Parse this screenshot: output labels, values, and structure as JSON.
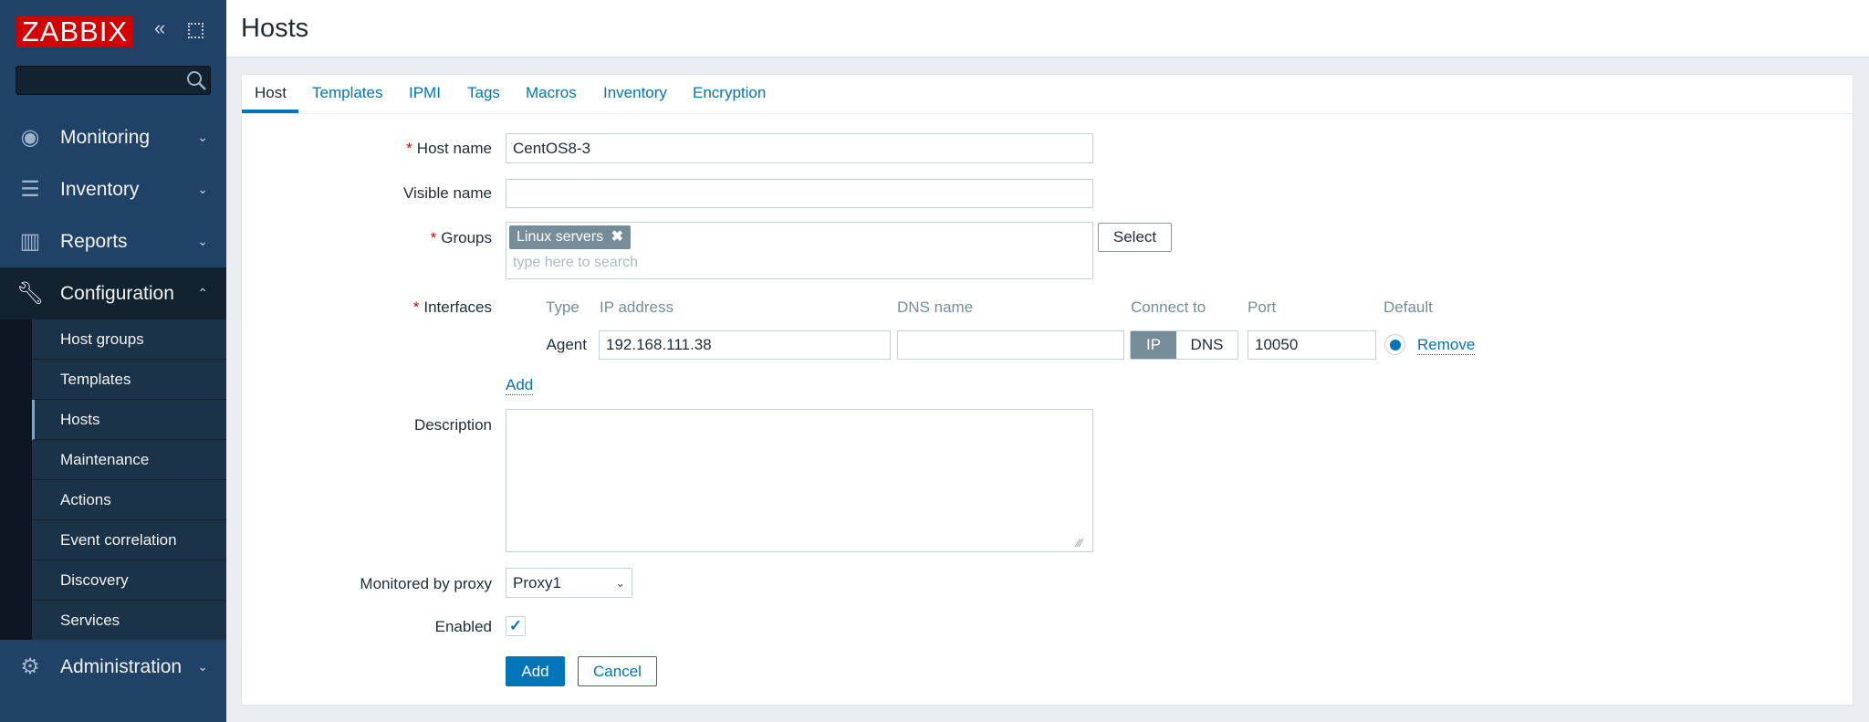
{
  "sidebar": {
    "logo": "ZABBIX",
    "search_value": "",
    "menu": [
      {
        "label": "Monitoring",
        "icon": "eye-icon"
      },
      {
        "label": "Inventory",
        "icon": "list-icon"
      },
      {
        "label": "Reports",
        "icon": "bar-chart-icon"
      },
      {
        "label": "Configuration",
        "icon": "wrench-icon"
      },
      {
        "label": "Administration",
        "icon": "gear-icon"
      }
    ],
    "submenu": [
      "Host groups",
      "Templates",
      "Hosts",
      "Maintenance",
      "Actions",
      "Event correlation",
      "Discovery",
      "Services"
    ],
    "selected_submenu": "Hosts"
  },
  "header": {
    "title": "Hosts"
  },
  "tabs": [
    "Host",
    "Templates",
    "IPMI",
    "Tags",
    "Macros",
    "Inventory",
    "Encryption"
  ],
  "active_tab": "Host",
  "form": {
    "host_name_label": "Host name",
    "host_name_value": "CentOS8-3",
    "visible_name_label": "Visible name",
    "visible_name_value": "",
    "groups_label": "Groups",
    "group_tag": "Linux servers",
    "groups_placeholder": "type here to search",
    "select_label": "Select",
    "interfaces_label": "Interfaces",
    "interface_headers": {
      "type": "Type",
      "ip": "IP address",
      "dns": "DNS name",
      "connect": "Connect to",
      "port": "Port",
      "default": "Default"
    },
    "interface": {
      "type": "Agent",
      "ip": "192.168.111.38",
      "dns": "",
      "connect_ip": "IP",
      "connect_dns": "DNS",
      "connect_selected": "IP",
      "port": "10050",
      "remove": "Remove"
    },
    "add_interface": "Add",
    "description_label": "Description",
    "description_value": "",
    "proxy_label": "Monitored by proxy",
    "proxy_value": "Proxy1",
    "enabled_label": "Enabled",
    "enabled": true,
    "add_button": "Add",
    "cancel_button": "Cancel"
  },
  "colors": {
    "sidebar": "#1f4266",
    "accent": "#0275b8",
    "logo": "#d40000",
    "required": "#d40000"
  }
}
